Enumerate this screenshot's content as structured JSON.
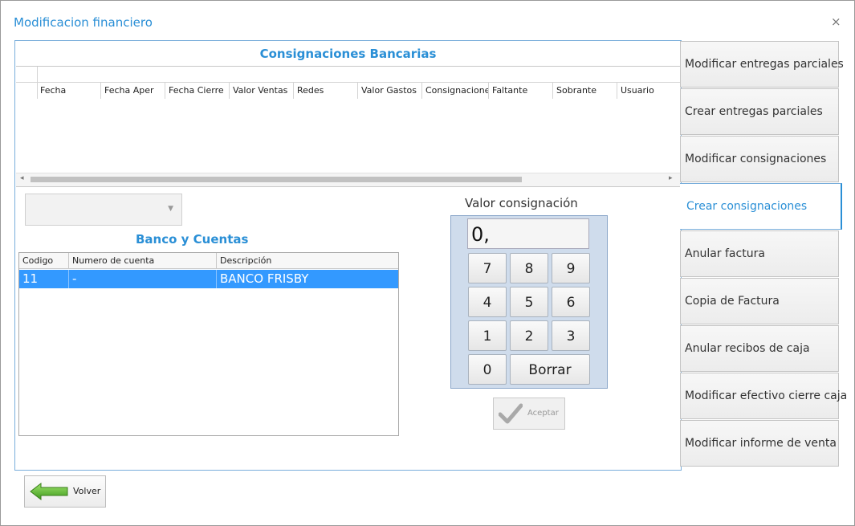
{
  "window": {
    "title": "Modificacion financiero",
    "close_glyph": "×"
  },
  "consignaciones": {
    "title": "Consignaciones Bancarias",
    "columns": [
      "Fecha",
      "Fecha Aper",
      "Fecha Cierre",
      "Valor Ventas",
      "Redes",
      "Valor Gastos",
      "Consignaciones",
      "Faltante",
      "Sobrante",
      "Usuario"
    ],
    "rows": []
  },
  "banco": {
    "title": "Banco y Cuentas",
    "columns": [
      "Codigo",
      "Numero de cuenta",
      "Descripción"
    ],
    "rows": [
      {
        "codigo": "11",
        "numero": "-",
        "descripcion": "BANCO FRISBY"
      }
    ]
  },
  "keypad": {
    "label": "Valor consignación",
    "display": "0,",
    "keys": [
      "7",
      "8",
      "9",
      "4",
      "5",
      "6",
      "1",
      "2",
      "3",
      "0"
    ],
    "borrar": "Borrar",
    "aceptar": "Aceptar"
  },
  "footer": {
    "volver": "Volver"
  },
  "sidebar": {
    "items": [
      {
        "label": "Modificar entregas parciales",
        "active": false
      },
      {
        "label": "Crear entregas parciales",
        "active": false
      },
      {
        "label": "Modificar consignaciones",
        "active": false
      },
      {
        "label": "Crear consignaciones",
        "active": true
      },
      {
        "label": "Anular factura",
        "active": false
      },
      {
        "label": "Copia de Factura",
        "active": false
      },
      {
        "label": "Anular recibos de caja",
        "active": false
      },
      {
        "label": "Modificar efectivo cierre caja",
        "active": false
      },
      {
        "label": "Modificar informe de venta",
        "active": false
      }
    ]
  },
  "colors": {
    "accent": "#2a8fd6",
    "selection": "#3399ff"
  }
}
